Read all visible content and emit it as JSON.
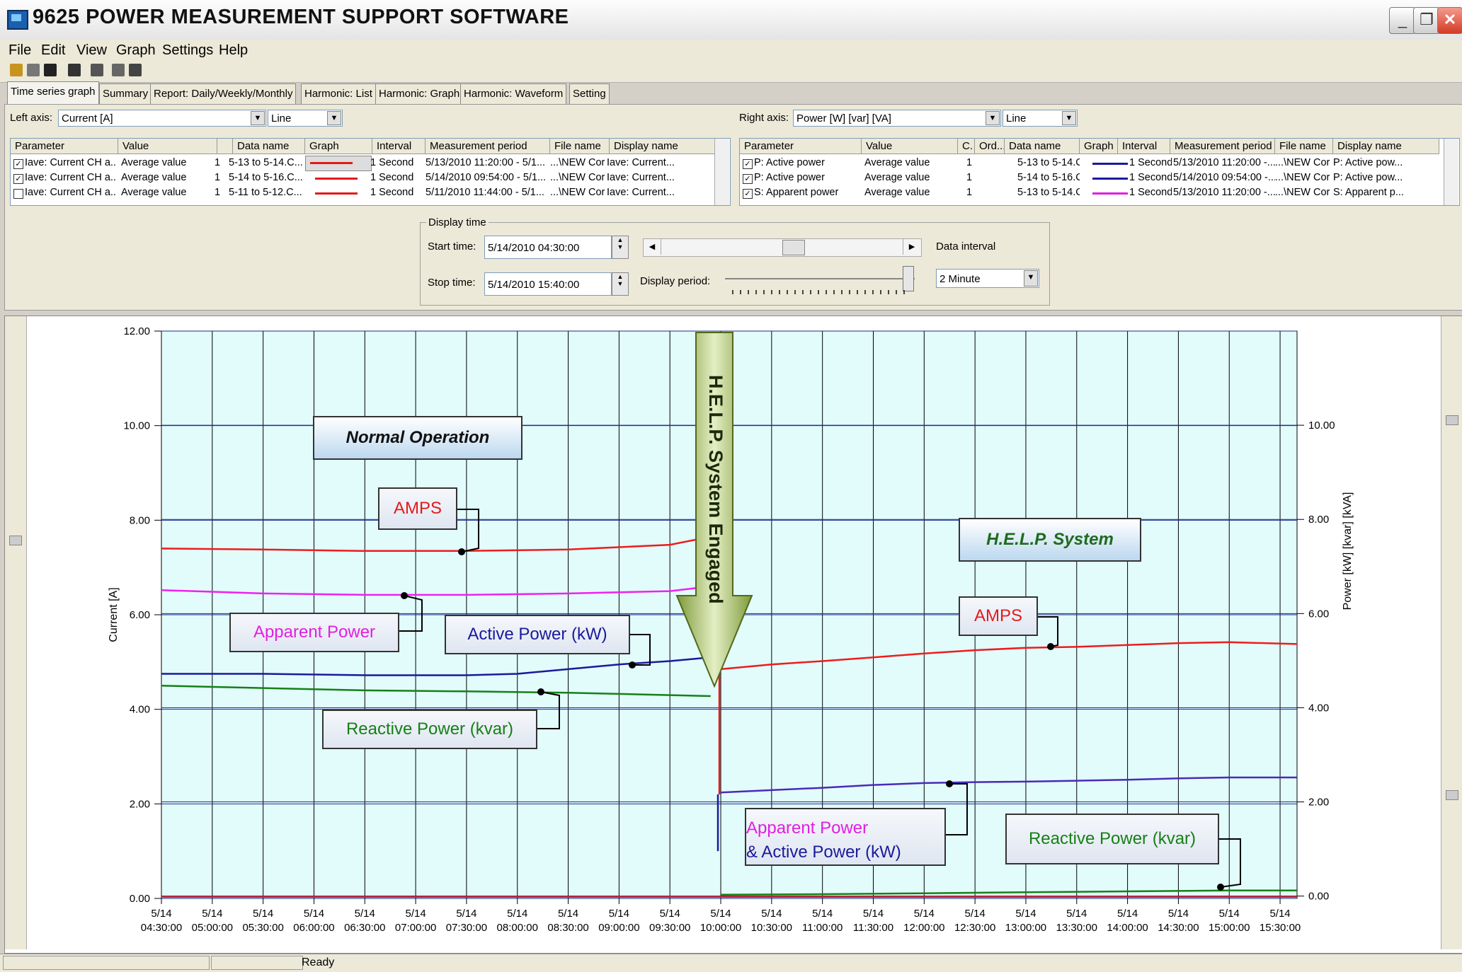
{
  "window": {
    "title": "9625 POWER MEASUREMENT SUPPORT SOFTWARE"
  },
  "menu": [
    "File",
    "Edit",
    "View",
    "Graph",
    "Settings",
    "Help"
  ],
  "tabs": [
    "Time series graph",
    "Summary",
    "Report: Daily/Weekly/Monthly",
    "Harmonic: List",
    "Harmonic: Graph",
    "Harmonic: Waveform",
    "Setting"
  ],
  "left_axis": {
    "label": "Left axis:",
    "value": "Current [A]",
    "style": "Line"
  },
  "right_axis": {
    "label": "Right axis:",
    "value": "Power [W] [var] [VA]",
    "style": "Line"
  },
  "left_table": {
    "headers": [
      "Parameter",
      "Value",
      "",
      "Data name",
      "Graph",
      "Interval",
      "Measurement period",
      "File name",
      "Display name"
    ],
    "rows": [
      {
        "checked": true,
        "parameter": "Iave: Current CH a...",
        "value": "Average value",
        "n": "1",
        "data": "5-13 to 5-14.C...",
        "color": "#e31a1a",
        "interval": "1 Second",
        "period": "5/13/2010 11:20:00 - 5/1...",
        "file": "...\\NEW Cor",
        "display": "Iave: Current..."
      },
      {
        "checked": true,
        "parameter": "Iave: Current CH a...",
        "value": "Average value",
        "n": "1",
        "data": "5-14 to 5-16.C...",
        "color": "#e31a1a",
        "interval": "1 Second",
        "period": "5/14/2010 09:54:00 - 5/1...",
        "file": "...\\NEW Cor",
        "display": "Iave: Current..."
      },
      {
        "checked": false,
        "parameter": "Iave: Current CH a...",
        "value": "Average value",
        "n": "1",
        "data": "5-11 to 5-12.C...",
        "color": "#e31a1a",
        "interval": "1 Second",
        "period": "5/11/2010 11:44:00 - 5/1...",
        "file": "...\\NEW Cor",
        "display": "Iave: Current..."
      }
    ]
  },
  "right_table": {
    "headers": [
      "Parameter",
      "Value",
      "C.",
      "Ord...",
      "Data name",
      "Graph",
      "Interval",
      "Measurement period",
      "File name",
      "Display name"
    ],
    "rows": [
      {
        "checked": true,
        "parameter": "P: Active power",
        "value": "Average value",
        "n": "1",
        "data": "5-13 to 5-14.C...",
        "color": "#1a1aa0",
        "interval": "1 Second",
        "period": "5/13/2010 11:20:00 -...",
        "file": "...\\NEW Cor",
        "display": "P: Active pow..."
      },
      {
        "checked": true,
        "parameter": "P: Active power",
        "value": "Average value",
        "n": "1",
        "data": "5-14 to 5-16.C...",
        "color": "#1a1aa0",
        "interval": "1 Second",
        "period": "5/14/2010 09:54:00 -...",
        "file": "...\\NEW Cor",
        "display": "P: Active pow..."
      },
      {
        "checked": true,
        "parameter": "S: Apparent power",
        "value": "Average value",
        "n": "1",
        "data": "5-13 to 5-14.C...",
        "color": "#e020e0",
        "interval": "1 Second",
        "period": "5/13/2010 11:20:00 -...",
        "file": "...\\NEW Cor",
        "display": "S: Apparent p..."
      }
    ]
  },
  "display_time": {
    "group_label": "Display time",
    "start_label": "Start time:",
    "start_value": "5/14/2010  04:30:00",
    "stop_label": "Stop time:",
    "stop_value": "5/14/2010  15:40:00",
    "period_label": "Display period:",
    "interval_label": "Data interval",
    "interval_value": "2 Minute"
  },
  "status": {
    "text": "Ready"
  },
  "colors": {
    "current": "#ee1c1c",
    "active": "#1a1a9a",
    "apparent": "#f020f0",
    "reactive": "#168016",
    "plot_bg": "#e2fcfc"
  },
  "annotations": {
    "normal": "Normal Operation",
    "help_system": "H.E.L.P. System",
    "engaged": "H.E.L.P. System Engaged",
    "amps": "AMPS",
    "apparent": "Apparent Power",
    "active": "Active Power (kW)",
    "reactive": "Reactive Power (kvar)",
    "apparent_active_1": "Apparent Power",
    "apparent_active_2": "& Active Power (kW)"
  },
  "chart_data": {
    "type": "line",
    "ylabel": "Current [A]",
    "y2label": "Power [kW] [kvar] [kVA]",
    "ylim": [
      0,
      12
    ],
    "y2lim": [
      -0.05,
      12
    ],
    "yticks": [
      "0.00",
      "2.00",
      "4.00",
      "6.00",
      "8.00",
      "10.00",
      "12.00"
    ],
    "y2ticks": [
      "0.00",
      "2.00",
      "4.00",
      "6.00",
      "8.00",
      "10.00"
    ],
    "xticks": [
      [
        "5/14",
        "04:30:00"
      ],
      [
        "5/14",
        "05:00:00"
      ],
      [
        "5/14",
        "05:30:00"
      ],
      [
        "5/14",
        "06:00:00"
      ],
      [
        "5/14",
        "06:30:00"
      ],
      [
        "5/14",
        "07:00:00"
      ],
      [
        "5/14",
        "07:30:00"
      ],
      [
        "5/14",
        "08:00:00"
      ],
      [
        "5/14",
        "08:30:00"
      ],
      [
        "5/14",
        "09:00:00"
      ],
      [
        "5/14",
        "09:30:00"
      ],
      [
        "5/14",
        "10:00:00"
      ],
      [
        "5/14",
        "10:30:00"
      ],
      [
        "5/14",
        "11:00:00"
      ],
      [
        "5/14",
        "11:30:00"
      ],
      [
        "5/14",
        "12:00:00"
      ],
      [
        "5/14",
        "12:30:00"
      ],
      [
        "5/14",
        "13:00:00"
      ],
      [
        "5/14",
        "13:30:00"
      ],
      [
        "5/14",
        "14:00:00"
      ],
      [
        "5/14",
        "14:30:00"
      ],
      [
        "5/14",
        "15:00:00"
      ],
      [
        "5/14",
        "15:30:00"
      ]
    ],
    "series": [
      {
        "name": "AMPS",
        "axis": "left",
        "color": "#ee1c1c",
        "x": [
          "04:30",
          "05:30",
          "06:30",
          "07:30",
          "08:30",
          "09:30",
          "09:54",
          "10:00",
          "10:30",
          "11:00",
          "11:30",
          "12:00",
          "12:30",
          "13:00",
          "13:30",
          "14:00",
          "14:30",
          "15:00",
          "15:40"
        ],
        "y": [
          7.4,
          7.38,
          7.35,
          7.35,
          7.38,
          7.48,
          7.65,
          4.85,
          4.95,
          5.02,
          5.1,
          5.18,
          5.25,
          5.3,
          5.32,
          5.36,
          5.4,
          5.42,
          5.38
        ]
      },
      {
        "name": "Apparent Power",
        "axis": "left",
        "color": "#f020f0",
        "x": [
          "04:30",
          "05:30",
          "06:30",
          "07:30",
          "08:30",
          "09:30",
          "09:54"
        ],
        "y": [
          6.52,
          6.45,
          6.42,
          6.42,
          6.45,
          6.5,
          6.6
        ]
      },
      {
        "name": "Active Power (kW)",
        "axis": "left",
        "color": "#1a1a9a",
        "x": [
          "04:30",
          "05:30",
          "06:30",
          "07:30",
          "08:00",
          "08:30",
          "09:00",
          "09:30",
          "09:54"
        ],
        "y": [
          4.75,
          4.75,
          4.72,
          4.72,
          4.75,
          4.85,
          4.95,
          5.02,
          5.1
        ]
      },
      {
        "name": "Reactive Power (kvar)",
        "axis": "left",
        "color": "#168016",
        "x": [
          "04:30",
          "05:30",
          "06:30",
          "07:30",
          "08:30",
          "09:30",
          "09:54"
        ],
        "y": [
          4.5,
          4.45,
          4.4,
          4.38,
          4.35,
          4.3,
          4.28
        ]
      },
      {
        "name": "Apparent Power & Active Power (kW)",
        "axis": "right",
        "color": "#4a2ab8",
        "x": [
          "10:00",
          "10:30",
          "11:00",
          "11:30",
          "12:00",
          "12:30",
          "13:00",
          "13:30",
          "14:00",
          "14:30",
          "15:00",
          "15:40"
        ],
        "y": [
          2.2,
          2.25,
          2.3,
          2.36,
          2.4,
          2.42,
          2.43,
          2.45,
          2.47,
          2.5,
          2.52,
          2.52
        ]
      },
      {
        "name": "Reactive Power (kvar)",
        "axis": "right",
        "color": "#168016",
        "x": [
          "10:00",
          "11:00",
          "12:00",
          "13:00",
          "14:00",
          "15:00",
          "15:40"
        ],
        "y": [
          0.03,
          0.04,
          0.06,
          0.08,
          0.1,
          0.12,
          0.12
        ]
      }
    ]
  }
}
